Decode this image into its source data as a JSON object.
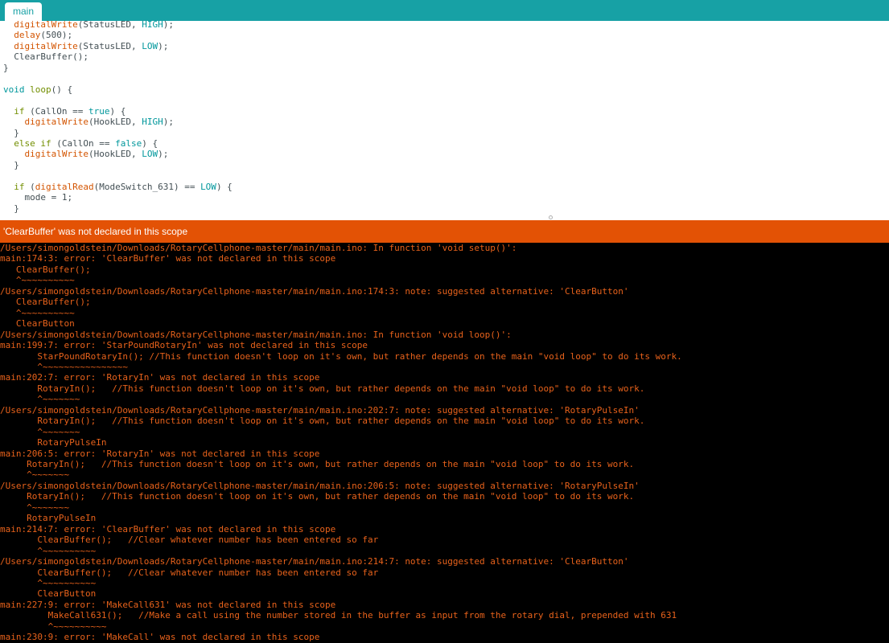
{
  "tabs": [
    {
      "label": "main"
    }
  ],
  "editor": {
    "lines": [
      {
        "indent": "  ",
        "parts": [
          [
            "fn",
            "digitalWrite"
          ],
          [
            "txt",
            "(StatusLED, "
          ],
          [
            "const",
            "HIGH"
          ],
          [
            "txt",
            ");"
          ]
        ]
      },
      {
        "indent": "  ",
        "parts": [
          [
            "fn",
            "delay"
          ],
          [
            "txt",
            "(500);"
          ]
        ]
      },
      {
        "indent": "  ",
        "parts": [
          [
            "fn",
            "digitalWrite"
          ],
          [
            "txt",
            "(StatusLED, "
          ],
          [
            "const",
            "LOW"
          ],
          [
            "txt",
            ");"
          ]
        ]
      },
      {
        "indent": "  ",
        "parts": [
          [
            "txt",
            "ClearBuffer();"
          ]
        ]
      },
      {
        "indent": "",
        "parts": [
          [
            "txt",
            "}"
          ]
        ]
      },
      {
        "indent": "",
        "parts": []
      },
      {
        "indent": "",
        "parts": [
          [
            "type",
            "void"
          ],
          [
            "txt",
            " "
          ],
          [
            "ctrl",
            "loop"
          ],
          [
            "txt",
            "() {"
          ]
        ]
      },
      {
        "indent": "",
        "parts": []
      },
      {
        "indent": "  ",
        "parts": [
          [
            "ctrl",
            "if"
          ],
          [
            "txt",
            " (CallOn == "
          ],
          [
            "const",
            "true"
          ],
          [
            "txt",
            ") {"
          ]
        ]
      },
      {
        "indent": "    ",
        "parts": [
          [
            "fn",
            "digitalWrite"
          ],
          [
            "txt",
            "(HookLED, "
          ],
          [
            "const",
            "HIGH"
          ],
          [
            "txt",
            ");"
          ]
        ]
      },
      {
        "indent": "  ",
        "parts": [
          [
            "txt",
            "}"
          ]
        ]
      },
      {
        "indent": "  ",
        "parts": [
          [
            "ctrl",
            "else"
          ],
          [
            "txt",
            " "
          ],
          [
            "ctrl",
            "if"
          ],
          [
            "txt",
            " (CallOn == "
          ],
          [
            "const",
            "false"
          ],
          [
            "txt",
            ") {"
          ]
        ]
      },
      {
        "indent": "    ",
        "parts": [
          [
            "fn",
            "digitalWrite"
          ],
          [
            "txt",
            "(HookLED, "
          ],
          [
            "const",
            "LOW"
          ],
          [
            "txt",
            ");"
          ]
        ]
      },
      {
        "indent": "  ",
        "parts": [
          [
            "txt",
            "}"
          ]
        ]
      },
      {
        "indent": "",
        "parts": []
      },
      {
        "indent": "  ",
        "parts": [
          [
            "ctrl",
            "if"
          ],
          [
            "txt",
            " ("
          ],
          [
            "fn",
            "digitalRead"
          ],
          [
            "txt",
            "(ModeSwitch_631) == "
          ],
          [
            "const",
            "LOW"
          ],
          [
            "txt",
            ") {"
          ]
        ]
      },
      {
        "indent": "    ",
        "parts": [
          [
            "txt",
            "mode = 1;"
          ]
        ]
      },
      {
        "indent": "  ",
        "parts": [
          [
            "txt",
            "}"
          ]
        ]
      }
    ]
  },
  "status": {
    "message": "'ClearBuffer' was not declared in this scope"
  },
  "console": {
    "lines": [
      "/Users/simongoldstein/Downloads/RotaryCellphone-master/main/main.ino: In function 'void setup()':",
      "main:174:3: error: 'ClearBuffer' was not declared in this scope",
      "   ClearBuffer();",
      "   ^~~~~~~~~~~",
      "/Users/simongoldstein/Downloads/RotaryCellphone-master/main/main.ino:174:3: note: suggested alternative: 'ClearButton'",
      "   ClearBuffer();",
      "   ^~~~~~~~~~~",
      "   ClearButton",
      "/Users/simongoldstein/Downloads/RotaryCellphone-master/main/main.ino: In function 'void loop()':",
      "main:199:7: error: 'StarPoundRotaryIn' was not declared in this scope",
      "       StarPoundRotaryIn(); //This function doesn't loop on it's own, but rather depends on the main \"void loop\" to do its work.",
      "       ^~~~~~~~~~~~~~~~~",
      "main:202:7: error: 'RotaryIn' was not declared in this scope",
      "       RotaryIn();   //This function doesn't loop on it's own, but rather depends on the main \"void loop\" to do its work.",
      "       ^~~~~~~~",
      "/Users/simongoldstein/Downloads/RotaryCellphone-master/main/main.ino:202:7: note: suggested alternative: 'RotaryPulseIn'",
      "       RotaryIn();   //This function doesn't loop on it's own, but rather depends on the main \"void loop\" to do its work.",
      "       ^~~~~~~~",
      "       RotaryPulseIn",
      "main:206:5: error: 'RotaryIn' was not declared in this scope",
      "     RotaryIn();   //This function doesn't loop on it's own, but rather depends on the main \"void loop\" to do its work.",
      "     ^~~~~~~~",
      "/Users/simongoldstein/Downloads/RotaryCellphone-master/main/main.ino:206:5: note: suggested alternative: 'RotaryPulseIn'",
      "     RotaryIn();   //This function doesn't loop on it's own, but rather depends on the main \"void loop\" to do its work.",
      "     ^~~~~~~~",
      "     RotaryPulseIn",
      "main:214:7: error: 'ClearBuffer' was not declared in this scope",
      "       ClearBuffer();   //Clear whatever number has been entered so far",
      "       ^~~~~~~~~~~",
      "/Users/simongoldstein/Downloads/RotaryCellphone-master/main/main.ino:214:7: note: suggested alternative: 'ClearButton'",
      "       ClearBuffer();   //Clear whatever number has been entered so far",
      "       ^~~~~~~~~~~",
      "       ClearButton",
      "main:227:9: error: 'MakeCall631' was not declared in this scope",
      "         MakeCall631();   //Make a call using the number stored in the buffer as input from the rotary dial, prepended with 631",
      "         ^~~~~~~~~~~",
      "main:230:9: error: 'MakeCall' was not declared in this scope"
    ]
  }
}
